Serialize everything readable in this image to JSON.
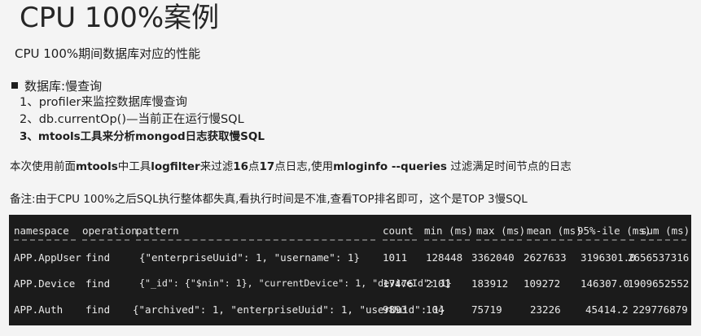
{
  "title": "CPU 100%案例",
  "subtitle": "CPU 100%期间数据库对应的性能",
  "bullet": {
    "prefix": "数据库:",
    "emph": "慢查询"
  },
  "steps": [
    "1、profiler来监控数据库慢查询",
    "2、db.currentOp()—当前正在运行慢SQL",
    "3、mtools工具来分析mongod日志获取慢SQL"
  ],
  "para1": {
    "p1": "本次使用前面",
    "b1": "mtools",
    "p2": "中工具",
    "b2": "logfilter",
    "p3": "来过滤",
    "b3": "16",
    "p4": "点",
    "b4": "17",
    "p5": "点日志,使用",
    "b5": "mloginfo --queries",
    "p6": " 过滤满足时间节点的日志"
  },
  "para2": "备注:由于CPU 100%之后SQL执行整体都失真,看执行时间是不准,查看TOP排名即可，这个是TOP 3慢SQL",
  "table": {
    "headers": [
      "namespace",
      "operation",
      "pattern",
      "count",
      "min (ms)",
      "max (ms)",
      "mean (ms)",
      "95%-ile (ms)",
      "sum (ms)"
    ],
    "rows": [
      [
        "APP.AppUser",
        "find",
        "{\"enterpriseUuid\": 1, \"username\": 1}",
        "1011",
        "128448",
        "3362040",
        "2627633",
        "3196301.0",
        "2656537316"
      ],
      [
        "APP.Device",
        "find",
        "{\"_id\": {\"$nin\": 1}, \"currentDevice\": 1, \"deviceId\": 1}",
        "17476",
        "2101",
        "183912",
        "109272",
        "146307.0",
        "1909652552"
      ],
      [
        "APP.Auth",
        "find",
        "{\"archived\": 1, \"enterpriseUuid\": 1, \"userUuid\": 1}",
        "9893",
        "104",
        "75719",
        "23226",
        "45414.2",
        "229776879"
      ]
    ]
  }
}
